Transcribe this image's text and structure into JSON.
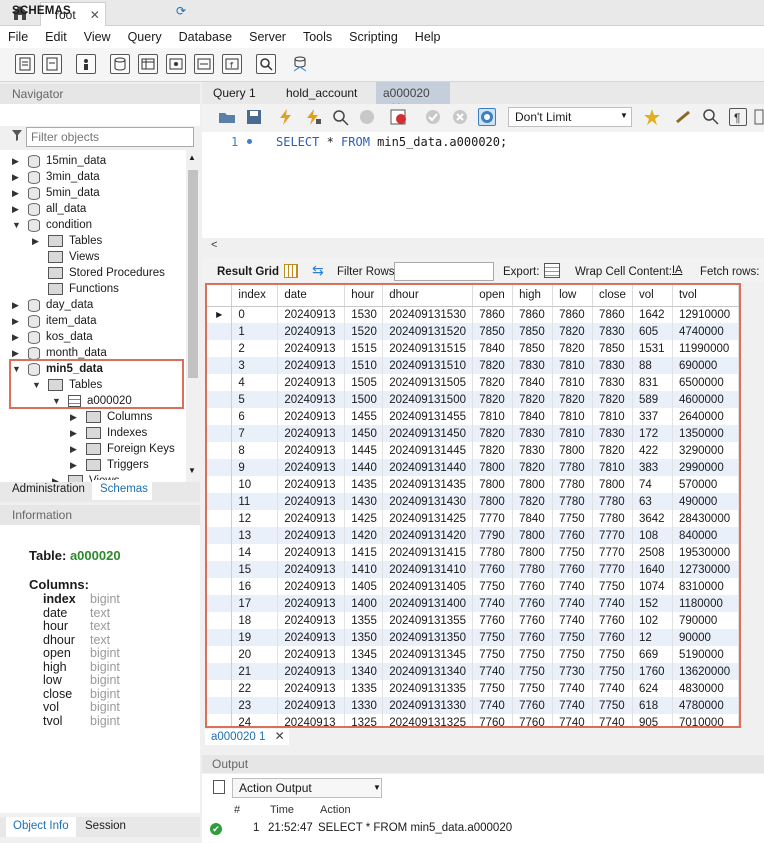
{
  "window": {
    "tab_label": "root"
  },
  "menu": [
    "File",
    "Edit",
    "View",
    "Query",
    "Database",
    "Server",
    "Tools",
    "Scripting",
    "Help"
  ],
  "navigator": {
    "header": "Navigator",
    "schemas_title": "SCHEMAS",
    "filter_placeholder": "Filter objects",
    "tree": [
      {
        "label": "15min_data",
        "level": 0,
        "kind": "db",
        "expanded": false
      },
      {
        "label": "3min_data",
        "level": 0,
        "kind": "db",
        "expanded": false
      },
      {
        "label": "5min_data",
        "level": 0,
        "kind": "db",
        "expanded": false
      },
      {
        "label": "all_data",
        "level": 0,
        "kind": "db",
        "expanded": false
      },
      {
        "label": "condition",
        "level": 0,
        "kind": "db",
        "expanded": true
      },
      {
        "label": "Tables",
        "level": 1,
        "kind": "folder",
        "expanded": false
      },
      {
        "label": "Views",
        "level": 1,
        "kind": "folder",
        "expanded": null
      },
      {
        "label": "Stored Procedures",
        "level": 1,
        "kind": "folder",
        "expanded": null
      },
      {
        "label": "Functions",
        "level": 1,
        "kind": "folder",
        "expanded": null
      },
      {
        "label": "day_data",
        "level": 0,
        "kind": "db",
        "expanded": false
      },
      {
        "label": "item_data",
        "level": 0,
        "kind": "db",
        "expanded": false
      },
      {
        "label": "kos_data",
        "level": 0,
        "kind": "db",
        "expanded": false
      },
      {
        "label": "month_data",
        "level": 0,
        "kind": "db",
        "expanded": false
      },
      {
        "label": "min5_data",
        "level": 0,
        "kind": "db",
        "expanded": true,
        "bold": true
      },
      {
        "label": "Tables",
        "level": 1,
        "kind": "folder",
        "expanded": true
      },
      {
        "label": "a000020",
        "level": 2,
        "kind": "table",
        "expanded": true
      },
      {
        "label": "Columns",
        "level": 3,
        "kind": "folder",
        "expanded": false
      },
      {
        "label": "Indexes",
        "level": 3,
        "kind": "folder",
        "expanded": false
      },
      {
        "label": "Foreign Keys",
        "level": 3,
        "kind": "folder",
        "expanded": false
      },
      {
        "label": "Triggers",
        "level": 3,
        "kind": "folder",
        "expanded": false
      },
      {
        "label": "Views",
        "level": 2,
        "kind": "folder",
        "expanded": false
      }
    ],
    "tab_admin": "Administration",
    "tab_schemas": "Schemas"
  },
  "information": {
    "header": "Information",
    "table_label": "Table:",
    "table_name": "a000020",
    "columns_label": "Columns:",
    "columns": [
      {
        "name": "index",
        "type": "bigint",
        "bold": true
      },
      {
        "name": "date",
        "type": "text"
      },
      {
        "name": "hour",
        "type": "text"
      },
      {
        "name": "dhour",
        "type": "text"
      },
      {
        "name": "open",
        "type": "bigint"
      },
      {
        "name": "high",
        "type": "bigint"
      },
      {
        "name": "low",
        "type": "bigint"
      },
      {
        "name": "close",
        "type": "bigint"
      },
      {
        "name": "vol",
        "type": "bigint"
      },
      {
        "name": "tvol",
        "type": "bigint"
      }
    ],
    "tab_object_info": "Object Info",
    "tab_session": "Session"
  },
  "query_tabs": [
    {
      "label": "Query 1",
      "active": false
    },
    {
      "label": "hold_account",
      "active": false
    },
    {
      "label": "a000020",
      "active": true
    }
  ],
  "editor": {
    "limit_select": "Don't Limit",
    "line_number": "1",
    "sql_keyword_select": "SELECT",
    "sql_star": " * ",
    "sql_keyword_from": "FROM",
    "sql_rest": " min5_data.a000020;"
  },
  "result_toolbar": {
    "result_grid": "Result Grid",
    "filter_rows": "Filter Rows:",
    "export": "Export:",
    "wrap_cell": "Wrap Cell Content:",
    "fetch_rows": "Fetch rows:"
  },
  "grid": {
    "columns": [
      "index",
      "date",
      "hour",
      "dhour",
      "open",
      "high",
      "low",
      "close",
      "vol",
      "tvol"
    ],
    "rows": [
      [
        "0",
        "20240913",
        "1530",
        "202409131530",
        "7860",
        "7860",
        "7860",
        "7860",
        "1642",
        "12910000"
      ],
      [
        "1",
        "20240913",
        "1520",
        "202409131520",
        "7850",
        "7850",
        "7820",
        "7830",
        "605",
        "4740000"
      ],
      [
        "2",
        "20240913",
        "1515",
        "202409131515",
        "7840",
        "7850",
        "7820",
        "7850",
        "1531",
        "11990000"
      ],
      [
        "3",
        "20240913",
        "1510",
        "202409131510",
        "7820",
        "7830",
        "7810",
        "7830",
        "88",
        "690000"
      ],
      [
        "4",
        "20240913",
        "1505",
        "202409131505",
        "7820",
        "7840",
        "7810",
        "7830",
        "831",
        "6500000"
      ],
      [
        "5",
        "20240913",
        "1500",
        "202409131500",
        "7820",
        "7820",
        "7820",
        "7820",
        "589",
        "4600000"
      ],
      [
        "6",
        "20240913",
        "1455",
        "202409131455",
        "7810",
        "7840",
        "7810",
        "7810",
        "337",
        "2640000"
      ],
      [
        "7",
        "20240913",
        "1450",
        "202409131450",
        "7820",
        "7830",
        "7810",
        "7830",
        "172",
        "1350000"
      ],
      [
        "8",
        "20240913",
        "1445",
        "202409131445",
        "7820",
        "7830",
        "7800",
        "7820",
        "422",
        "3290000"
      ],
      [
        "9",
        "20240913",
        "1440",
        "202409131440",
        "7800",
        "7820",
        "7780",
        "7810",
        "383",
        "2990000"
      ],
      [
        "10",
        "20240913",
        "1435",
        "202409131435",
        "7800",
        "7800",
        "7780",
        "7800",
        "74",
        "570000"
      ],
      [
        "11",
        "20240913",
        "1430",
        "202409131430",
        "7800",
        "7820",
        "7780",
        "7780",
        "63",
        "490000"
      ],
      [
        "12",
        "20240913",
        "1425",
        "202409131425",
        "7770",
        "7840",
        "7750",
        "7780",
        "3642",
        "28430000"
      ],
      [
        "13",
        "20240913",
        "1420",
        "202409131420",
        "7790",
        "7800",
        "7760",
        "7770",
        "108",
        "840000"
      ],
      [
        "14",
        "20240913",
        "1415",
        "202409131415",
        "7780",
        "7800",
        "7750",
        "7770",
        "2508",
        "19530000"
      ],
      [
        "15",
        "20240913",
        "1410",
        "202409131410",
        "7760",
        "7780",
        "7760",
        "7770",
        "1640",
        "12730000"
      ],
      [
        "16",
        "20240913",
        "1405",
        "202409131405",
        "7750",
        "7760",
        "7740",
        "7750",
        "1074",
        "8310000"
      ],
      [
        "17",
        "20240913",
        "1400",
        "202409131400",
        "7740",
        "7760",
        "7740",
        "7740",
        "152",
        "1180000"
      ],
      [
        "18",
        "20240913",
        "1355",
        "202409131355",
        "7760",
        "7760",
        "7740",
        "7760",
        "102",
        "790000"
      ],
      [
        "19",
        "20240913",
        "1350",
        "202409131350",
        "7750",
        "7760",
        "7750",
        "7760",
        "12",
        "90000"
      ],
      [
        "20",
        "20240913",
        "1345",
        "202409131345",
        "7750",
        "7750",
        "7750",
        "7750",
        "669",
        "5190000"
      ],
      [
        "21",
        "20240913",
        "1340",
        "202409131340",
        "7740",
        "7750",
        "7730",
        "7750",
        "1760",
        "13620000"
      ],
      [
        "22",
        "20240913",
        "1335",
        "202409131335",
        "7750",
        "7750",
        "7740",
        "7740",
        "624",
        "4830000"
      ],
      [
        "23",
        "20240913",
        "1330",
        "202409131330",
        "7740",
        "7760",
        "7740",
        "7750",
        "618",
        "4780000"
      ],
      [
        "24",
        "20240913",
        "1325",
        "202409131325",
        "7760",
        "7760",
        "7740",
        "7740",
        "905",
        "7010000"
      ]
    ]
  },
  "result_tab": "a000020 1",
  "output": {
    "header": "Output",
    "select": "Action Output",
    "col_hash": "#",
    "col_time": "Time",
    "col_action": "Action",
    "entry_num": "1",
    "entry_time": "21:52:47",
    "entry_action": "SELECT * FROM min5_data.a000020"
  },
  "colors": {
    "highlight_border": "#d9705a",
    "accent_blue": "#1e6fb0",
    "table_green": "#2d8a2d"
  }
}
